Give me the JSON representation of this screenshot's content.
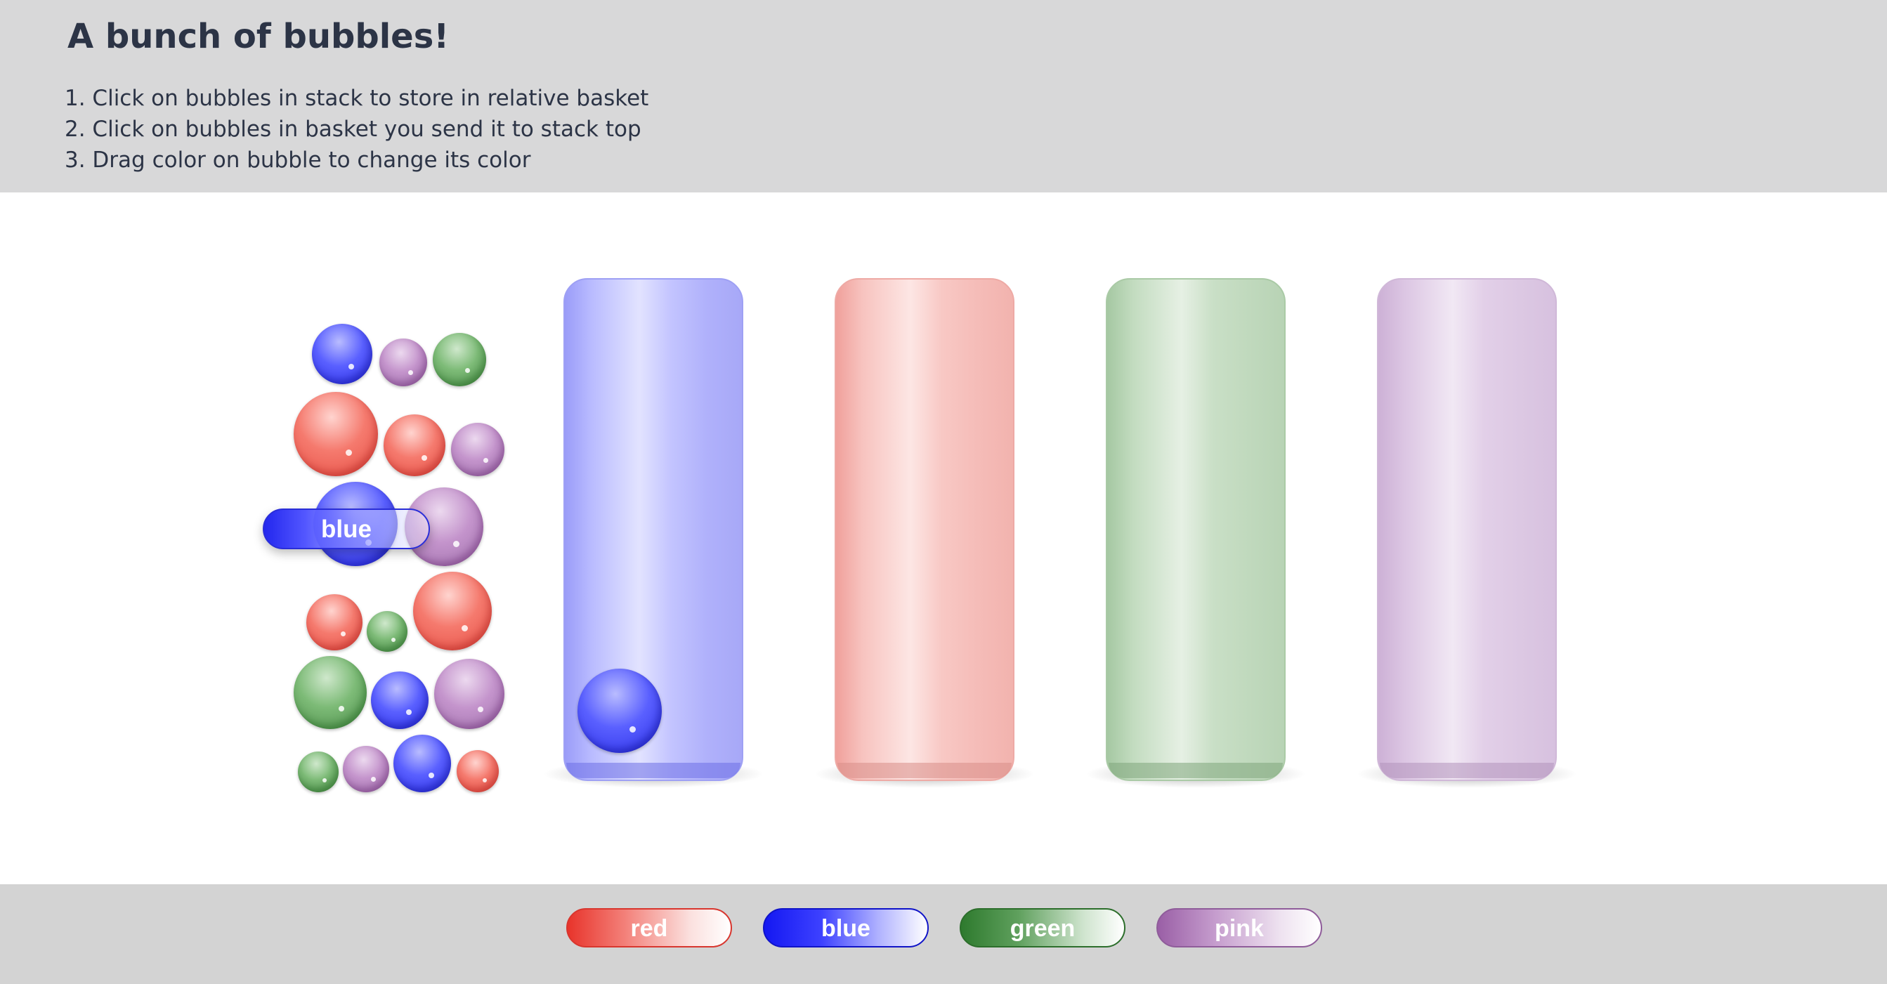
{
  "header": {
    "title": "A bunch of bubbles!",
    "steps": [
      "1. Click on bubbles in stack to store in relative basket",
      "2. Click on bubbles in basket you send it to stack top",
      "3. Drag color on bubble to change its color"
    ]
  },
  "stack": {
    "bubbles": [
      {
        "color": "blue"
      },
      {
        "color": "pink"
      },
      {
        "color": "green"
      },
      {
        "color": "red"
      },
      {
        "color": "red"
      },
      {
        "color": "pink"
      },
      {
        "color": "blue"
      },
      {
        "color": "pink"
      },
      {
        "color": "red"
      },
      {
        "color": "green"
      },
      {
        "color": "red"
      },
      {
        "color": "green"
      },
      {
        "color": "blue"
      },
      {
        "color": "pink"
      },
      {
        "color": "green"
      },
      {
        "color": "pink"
      },
      {
        "color": "blue"
      },
      {
        "color": "red"
      }
    ]
  },
  "baskets": [
    {
      "color": "blue",
      "bubble_count": 1
    },
    {
      "color": "red",
      "bubble_count": 0
    },
    {
      "color": "green",
      "bubble_count": 0
    },
    {
      "color": "pink",
      "bubble_count": 0
    }
  ],
  "dragging": {
    "label": "blue"
  },
  "palette": {
    "colors": [
      {
        "label": "red",
        "hex": "#e8342b"
      },
      {
        "label": "blue",
        "hex": "#1418f2"
      },
      {
        "label": "green",
        "hex": "#2e7a2e"
      },
      {
        "label": "pink",
        "hex": "#9a5fa6"
      }
    ]
  }
}
